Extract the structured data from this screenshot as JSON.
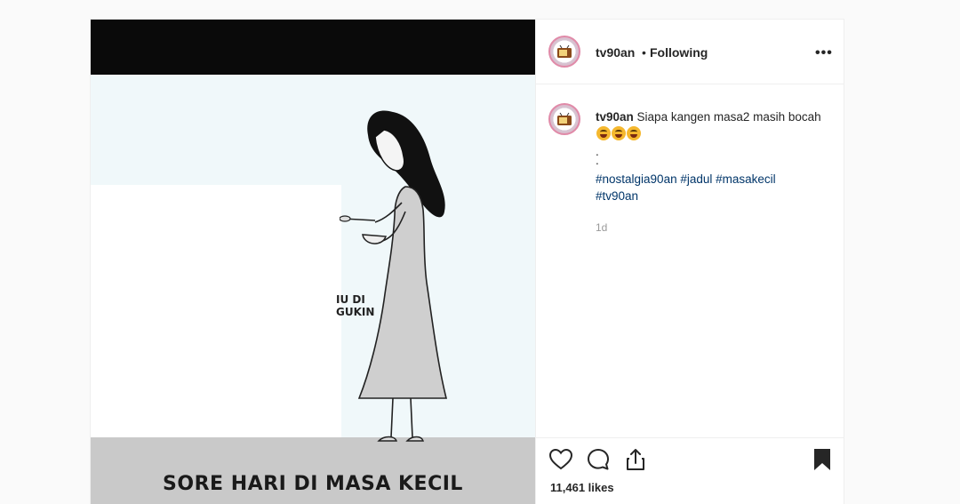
{
  "post": {
    "username": "tv90an",
    "separator": "•",
    "follow_status": "Following",
    "more_label": "•••",
    "caption": {
      "username": "tv90an",
      "text": "Siapa kangen masa2 masih bocah",
      "dots": [
        ".",
        "."
      ],
      "hashtags": [
        "#nostalgia90an",
        "#jadul",
        "#masakecil",
        "#tv90an"
      ]
    },
    "timestamp": "1d",
    "likes": "11,461 likes"
  },
  "media": {
    "wall_text": "IU DI\nGUKIN",
    "caption": "SORE HARI DI MASA KECIL"
  },
  "icons": {
    "like": "heart-icon",
    "comment": "comment-bubble-icon",
    "share": "share-icon",
    "save": "bookmark-icon",
    "avatar": "tv-icon"
  },
  "colors": {
    "hashtag": "#003569",
    "text": "#262626",
    "muted": "#999999"
  }
}
